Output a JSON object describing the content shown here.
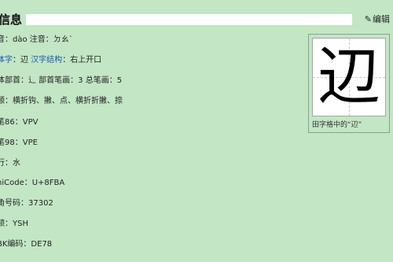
{
  "header": {
    "title": "信息",
    "edit_label": "编辑"
  },
  "rows": [
    {
      "label": "音：",
      "value": "dào 注音：ㄉㄠˋ"
    },
    {
      "label_link": "体字",
      "mid": "：辺 ",
      "link2": "汉字结构",
      "value": "：右上开口"
    },
    {
      "label": "体部首：",
      "value": "⻌ 部首笔画：3 总笔画：5"
    },
    {
      "label": "顺：",
      "value": "横折钩、撇、点、横折折撇、捺"
    },
    {
      "label": "笔86：",
      "value": "VPV"
    },
    {
      "label": "笔98：",
      "value": "VPE"
    },
    {
      "label": "行：",
      "value": "水"
    },
    {
      "label": "niCode：",
      "value": "U+8FBA"
    },
    {
      "label": "角号码：",
      "value": "37302"
    },
    {
      "label": "颉：",
      "value": "YSH"
    },
    {
      "label": "BK编码：",
      "value": "DE78"
    }
  ],
  "char_card": {
    "glyph": "辺",
    "caption": "田字格中的“辺”"
  }
}
